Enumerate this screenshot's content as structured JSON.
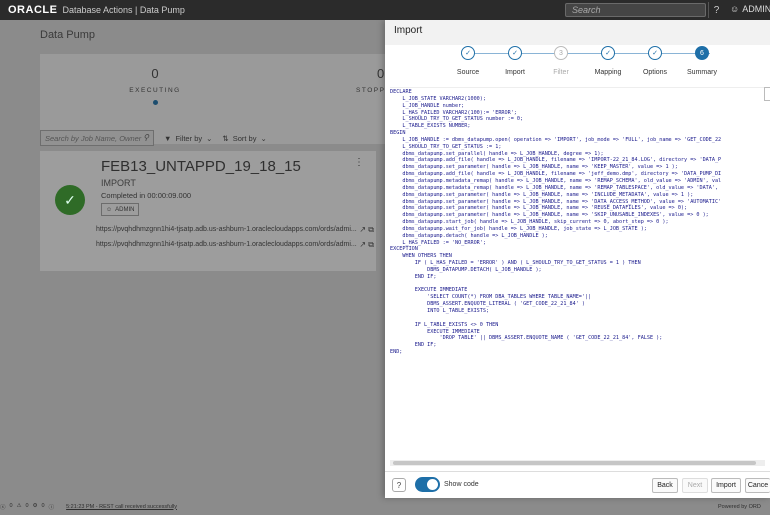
{
  "topbar": {
    "brand": "ORACLE",
    "app_title": "Database Actions | Data Pump",
    "search_placeholder": "Search",
    "user": "ADMIN"
  },
  "background": {
    "page_title": "Data Pump",
    "stats": [
      {
        "count": "0",
        "label": "EXECUTING"
      },
      {
        "count": "0",
        "label": "STOPP"
      }
    ],
    "search_placeholder": "Search by Job Name, Owner",
    "filter_label": "Filter by",
    "sort_label": "Sort by",
    "job": {
      "name": "FEB13_UNTAPPD_19_18_15",
      "type": "IMPORT",
      "status": "Completed in 00:00:09.000",
      "owner": "ADMIN",
      "urls": [
        "https://pvqhdhmzgnn1hi4-tjsatp.adb.us-ashburn-1.oraclecloudapps.com/ords/admi...",
        "https://pvqhdhmzgnn1hi4-tjsatp.adb.us-ashburn-1.oraclecloudapps.com/ords/admi..."
      ]
    }
  },
  "statusbar": {
    "counts": [
      "0",
      "0",
      "0",
      "0"
    ],
    "message": "5:21:23 PM - REST call received successfully"
  },
  "dialog": {
    "title": "Import",
    "steps": [
      {
        "label": "Source",
        "state": "done",
        "num": ""
      },
      {
        "label": "Import",
        "state": "done",
        "num": ""
      },
      {
        "label": "Filter",
        "state": "todo",
        "num": "3"
      },
      {
        "label": "Mapping",
        "state": "done",
        "num": ""
      },
      {
        "label": "Options",
        "state": "done",
        "num": ""
      },
      {
        "label": "Summary",
        "state": "current",
        "num": "6"
      }
    ],
    "code": "DECLARE\n    L_JOB_STATE VARCHAR2(1000);\n    L_JOB_HANDLE number;\n    L_HAS_FAILED VARCHAR2(100):= 'ERROR';\n    L_SHOULD_TRY_TO_GET_STATUS number := 0;\n    L_TABLE_EXISTS NUMBER;\nBEGIN\n    L_JOB_HANDLE := dbms_datapump.open( operation => 'IMPORT', job_mode => 'FULL', job_name => 'GET_CODE_22\n    L_SHOULD_TRY_TO_GET_STATUS := 1;\n    dbms_datapump.set_parallel( handle => L_JOB_HANDLE, degree => 1);\n    dbms_datapump.add_file( handle => L_JOB_HANDLE, filename => 'IMPORT-22_21_84.LOG', directory => 'DATA_P\n    dbms_datapump.set_parameter( handle => L_JOB_HANDLE, name => 'KEEP_MASTER', value => 1 );\n    dbms_datapump.add_file( handle => L_JOB_HANDLE, filename => 'jeff_demo.dmp', directory => 'DATA_PUMP_DI\n    dbms_datapump.metadata_remap( handle => L_JOB_HANDLE, name => 'REMAP_SCHEMA', old_value => 'ADMIN', val\n    dbms_datapump.metadata_remap( handle => L_JOB_HANDLE, name => 'REMAP_TABLESPACE', old_value => 'DATA',\n    dbms_datapump.set_parameter( handle => L_JOB_HANDLE, name => 'INCLUDE_METADATA', value => 1 );\n    dbms_datapump.set_parameter( handle => L_JOB_HANDLE, name => 'DATA_ACCESS_METHOD', value => 'AUTOMATIC'\n    dbms_datapump.set_parameter( handle => L_JOB_HANDLE, name => 'REUSE_DATAFILES', value => 0);\n    dbms_datapump.set_parameter( handle => L_JOB_HANDLE, name => 'SKIP_UNUSABLE_INDEXES', value => 0 );\n    dbms_datapump.start_job( handle => L_JOB_HANDLE, skip_current => 0, abort_step => 0 );\n    dbms_datapump.wait_for_job( handle => L_JOB_HANDLE, job_state => L_JOB_STATE );\n    dbms_datapump.detach( handle => L_JOB_HANDLE );\n    L_HAS_FAILED := 'NO_ERROR';\nEXCEPTION\n    WHEN OTHERS THEN\n        IF ( L_HAS_FAILED = 'ERROR' ) AND ( L_SHOULD_TRY_TO_GET_STATUS = 1 ) THEN\n            DBMS_DATAPUMP.DETACH( L_JOB_HANDLE );\n        END IF;\n\n        EXECUTE IMMEDIATE\n            'SELECT COUNT(*) FROM DBA_TABLES WHERE TABLE_NAME='||\n            DBMS_ASSERT.ENQUOTE_LITERAL ( 'GET_CODE_22_21_84' )\n            INTO L_TABLE_EXISTS;\n\n        IF L_TABLE_EXISTS <> 0 THEN\n            EXECUTE IMMEDIATE\n                'DROP TABLE' || DBMS_ASSERT.ENQUOTE_NAME ( 'GET_CODE_22_21_84', FALSE );\n        END IF;\nEND;",
    "footer": {
      "help": "?",
      "show_code_label": "Show code",
      "back": "Back",
      "next": "Next",
      "import": "Import",
      "cancel": "Cance",
      "powered": "Powered by ORD"
    }
  }
}
